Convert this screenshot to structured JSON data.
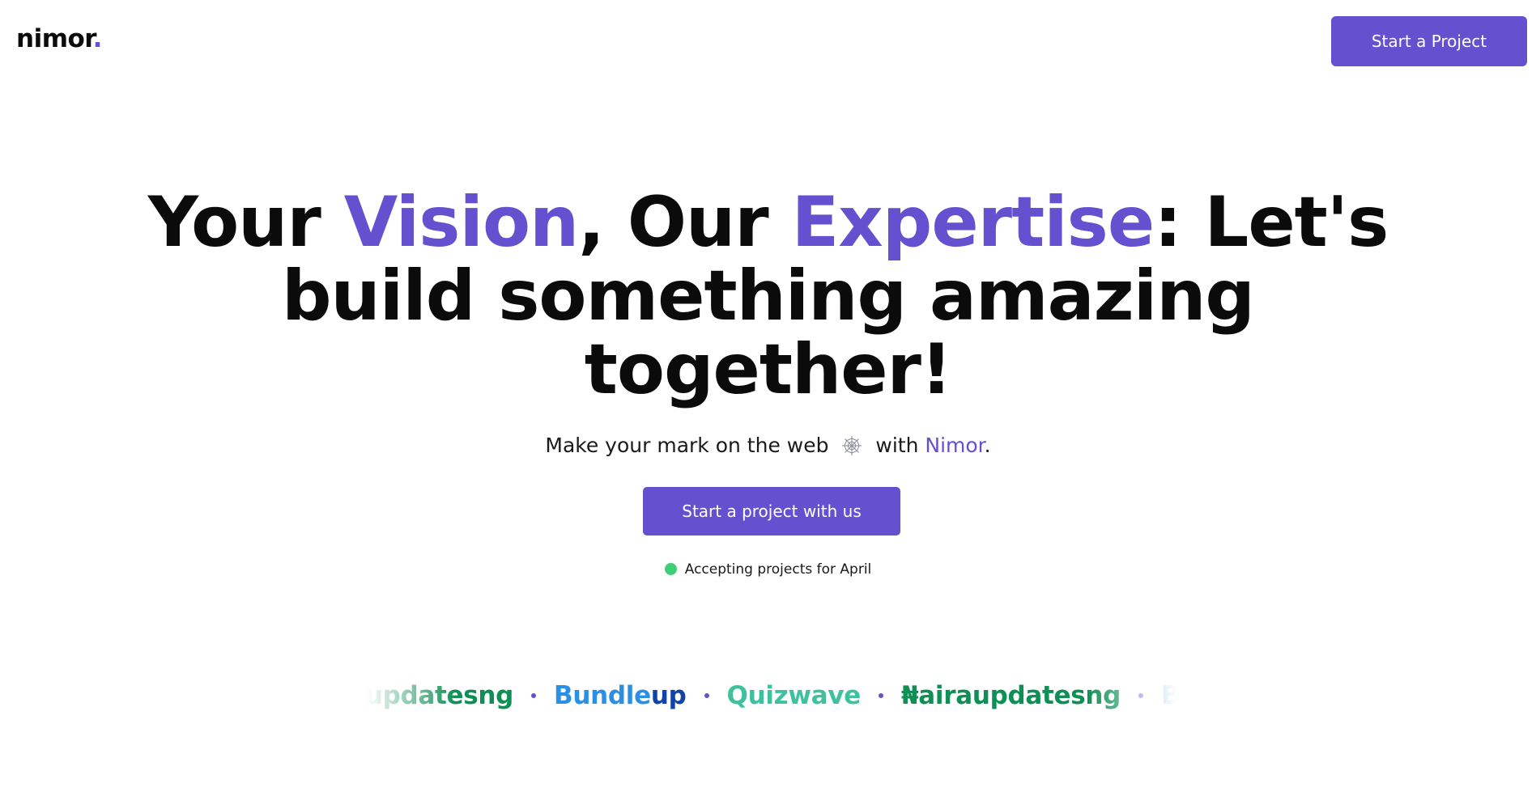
{
  "header": {
    "logo_text": "nimor",
    "logo_dot": ".",
    "cta_label": "Start a Project"
  },
  "hero": {
    "line1_a": "Your ",
    "line1_accent1": "Vision",
    "line1_b": ", Our ",
    "line1_accent2": "Expertise",
    "line1_c": ": Let's",
    "line2": "build something amazing",
    "line3": "together!",
    "sub_before": "Make your mark on the web",
    "sub_with": "with",
    "sub_brand": "Nimor",
    "sub_end": ".",
    "cta_label": "Start a project with us",
    "status_text": "Accepting projects for April"
  },
  "clients": [
    {
      "name_a": "₦airaupdatesng",
      "name_b": ""
    },
    {
      "name_a": "Bundle",
      "name_b": "up"
    },
    {
      "name_a": "Quizwave",
      "name_b": ""
    },
    {
      "name_a": "₦airaupdatesng",
      "name_b": ""
    },
    {
      "name_a": "Bundle",
      "name_b": "up"
    }
  ],
  "colors": {
    "accent": "#6550cf",
    "status_green": "#3ccf73",
    "naira_green": "#0f8f55",
    "bundle_blue": "#2b8fe6",
    "bundle_dark": "#1244a8",
    "quiz_teal": "#3fc1a0"
  },
  "icons": {
    "web": "spider-web-icon",
    "status": "status-dot-icon"
  }
}
